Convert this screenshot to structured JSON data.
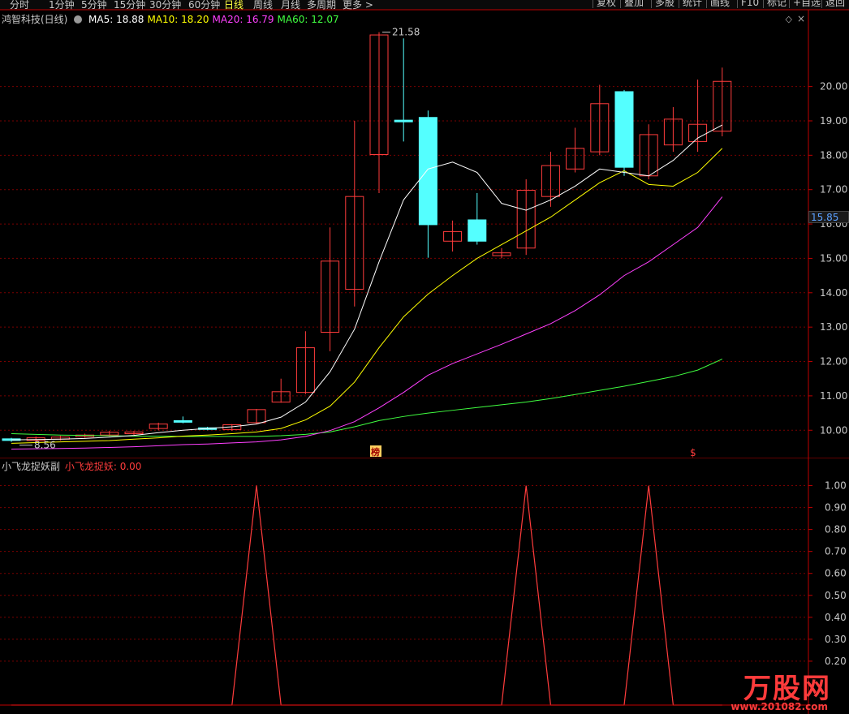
{
  "periods": [
    "分时",
    "1分钟",
    "5分钟",
    "15分钟",
    "30分钟",
    "60分钟",
    "日线",
    "周线",
    "月线",
    "多周期",
    "更多 >"
  ],
  "active_period": "日线",
  "toolbar": [
    "复权",
    "叠加",
    "多股",
    "统计",
    "画线",
    "F10",
    "标记",
    "+自选",
    "返回"
  ],
  "stock": {
    "name": "鸿智科技(日线)"
  },
  "ma_legend": [
    {
      "label": "MA5: 18.88",
      "color": "#ffffff"
    },
    {
      "label": "MA10: 18.20",
      "color": "#ffff00"
    },
    {
      "label": "MA20: 16.79",
      "color": "#ff40ff"
    },
    {
      "label": "MA60: 12.07",
      "color": "#40ff40"
    }
  ],
  "price_axis": [
    "20.00",
    "19.00",
    "18.00",
    "17.00",
    "16.00",
    "15.00",
    "14.00",
    "13.00",
    "12.00",
    "11.00",
    "10.00"
  ],
  "current_price": "15.85",
  "annotations": {
    "high": "21.58",
    "low": "8.56",
    "bang": "榜",
    "dollar": "$"
  },
  "indicator": {
    "name": "小飞龙捉妖副",
    "series": "小飞龙捉妖: 0.00"
  },
  "indicator_axis": [
    "1.00",
    "0.90",
    "0.80",
    "0.70",
    "0.60",
    "0.50",
    "0.40",
    "0.30",
    "0.20"
  ],
  "watermark": {
    "brand": "万股网",
    "site": "www.201082.com"
  },
  "colors": {
    "up": "#ff3c3c",
    "down": "#54ffff",
    "ma5": "#ffffff",
    "ma10": "#ffff00",
    "ma20": "#ff40ff",
    "ma60": "#40ff40",
    "grid": "#7a0000"
  },
  "chart_data": {
    "type": "candlestick",
    "candles": [
      {
        "o": 9.75,
        "c": 9.72,
        "h": 9.78,
        "l": 9.66
      },
      {
        "o": 9.7,
        "c": 9.78,
        "h": 9.82,
        "l": 9.66
      },
      {
        "o": 9.74,
        "c": 9.8,
        "h": 9.84,
        "l": 9.7
      },
      {
        "o": 9.82,
        "c": 9.86,
        "h": 9.9,
        "l": 9.78
      },
      {
        "o": 9.86,
        "c": 9.94,
        "h": 9.98,
        "l": 9.82
      },
      {
        "o": 9.9,
        "c": 9.95,
        "h": 9.98,
        "l": 9.86
      },
      {
        "o": 10.05,
        "c": 10.18,
        "h": 10.22,
        "l": 10.0
      },
      {
        "o": 10.28,
        "c": 10.24,
        "h": 10.4,
        "l": 10.2
      },
      {
        "o": 10.07,
        "c": 10.04,
        "h": 10.1,
        "l": 10.0
      },
      {
        "o": 10.02,
        "c": 10.16,
        "h": 10.18,
        "l": 9.98
      },
      {
        "o": 10.22,
        "c": 10.6,
        "h": 10.62,
        "l": 10.18
      },
      {
        "o": 10.82,
        "c": 11.12,
        "h": 11.5,
        "l": 10.8
      },
      {
        "o": 11.1,
        "c": 12.4,
        "h": 12.88,
        "l": 11.05
      },
      {
        "o": 12.85,
        "c": 14.92,
        "h": 15.9,
        "l": 12.3
      },
      {
        "o": 14.1,
        "c": 16.8,
        "h": 19.0,
        "l": 13.6
      },
      {
        "o": 18.02,
        "c": 21.5,
        "h": 21.58,
        "l": 16.9
      },
      {
        "o": 19.02,
        "c": 18.98,
        "h": 21.4,
        "l": 18.4
      },
      {
        "o": 19.1,
        "c": 15.98,
        "h": 19.3,
        "l": 15.02
      },
      {
        "o": 15.5,
        "c": 15.78,
        "h": 16.1,
        "l": 15.2
      },
      {
        "o": 16.12,
        "c": 15.5,
        "h": 16.9,
        "l": 15.4
      },
      {
        "o": 15.08,
        "c": 15.16,
        "h": 15.3,
        "l": 15.0
      },
      {
        "o": 15.3,
        "c": 16.98,
        "h": 17.3,
        "l": 15.1
      },
      {
        "o": 16.8,
        "c": 17.7,
        "h": 18.1,
        "l": 16.5
      },
      {
        "o": 17.6,
        "c": 18.2,
        "h": 18.8,
        "l": 17.5
      },
      {
        "o": 18.1,
        "c": 19.5,
        "h": 20.05,
        "l": 18.0
      },
      {
        "o": 19.85,
        "c": 17.65,
        "h": 19.9,
        "l": 17.4
      },
      {
        "o": 17.4,
        "c": 18.6,
        "h": 18.9,
        "l": 17.3
      },
      {
        "o": 18.3,
        "c": 19.05,
        "h": 19.4,
        "l": 18.1
      },
      {
        "o": 18.4,
        "c": 18.9,
        "h": 20.2,
        "l": 18.1
      },
      {
        "o": 18.7,
        "c": 20.15,
        "h": 20.55,
        "l": 18.55
      }
    ],
    "ma5": [
      9.72,
      9.73,
      9.74,
      9.76,
      9.8,
      9.85,
      9.93,
      10.0,
      10.05,
      10.1,
      10.18,
      10.38,
      10.82,
      11.7,
      12.94,
      14.9,
      16.7,
      17.6,
      17.8,
      17.5,
      16.6,
      16.4,
      16.7,
      17.1,
      17.6,
      17.5,
      17.4,
      17.85,
      18.5,
      18.88
    ],
    "ma10": [
      9.62,
      9.64,
      9.66,
      9.68,
      9.7,
      9.74,
      9.78,
      9.83,
      9.86,
      9.9,
      9.95,
      10.05,
      10.3,
      10.7,
      11.4,
      12.4,
      13.3,
      13.96,
      14.5,
      15.0,
      15.4,
      15.8,
      16.2,
      16.7,
      17.2,
      17.55,
      17.15,
      17.1,
      17.5,
      18.2
    ],
    "ma20": [
      9.45,
      9.46,
      9.47,
      9.48,
      9.5,
      9.52,
      9.55,
      9.58,
      9.6,
      9.63,
      9.66,
      9.72,
      9.82,
      9.99,
      10.25,
      10.65,
      11.1,
      11.6,
      11.94,
      12.22,
      12.5,
      12.8,
      13.1,
      13.48,
      13.94,
      14.5,
      14.9,
      15.4,
      15.9,
      16.79
    ],
    "ma60": [
      9.9,
      9.88,
      9.86,
      9.85,
      9.84,
      9.83,
      9.83,
      9.82,
      9.82,
      9.82,
      9.82,
      9.84,
      9.88,
      9.95,
      10.1,
      10.28,
      10.4,
      10.5,
      10.58,
      10.66,
      10.74,
      10.82,
      10.92,
      11.04,
      11.16,
      11.28,
      11.42,
      11.56,
      11.75,
      12.07
    ],
    "indicator_values": [
      0,
      0,
      0,
      0,
      0,
      0,
      0,
      0,
      0,
      0,
      1,
      0,
      0,
      0,
      0,
      0,
      0,
      0,
      0,
      0,
      0,
      1,
      0,
      0,
      0,
      0,
      1,
      0,
      0,
      0
    ],
    "ylim": [
      9.18,
      21.95
    ],
    "indicator_ylim": [
      0,
      1.05
    ]
  }
}
